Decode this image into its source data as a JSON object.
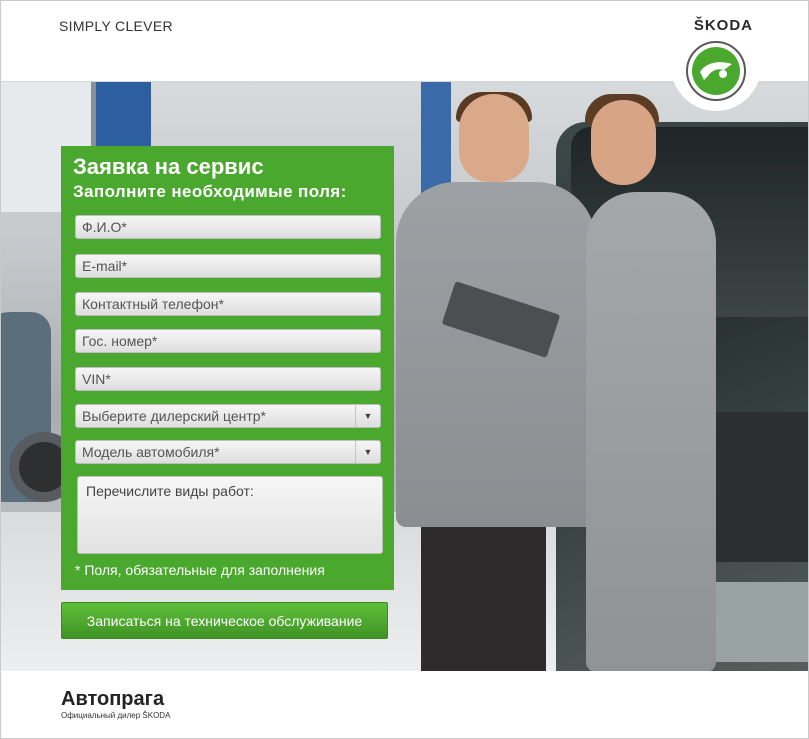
{
  "header": {
    "tagline": "SIMPLY CLEVER",
    "brand": "ŠKODA"
  },
  "colors": {
    "accent_green": "#4ba82e",
    "button_green": "#4fae30"
  },
  "form": {
    "title": "Заявка на сервис",
    "subtitle": "Заполните необходимые поля:",
    "fields": {
      "name": "Ф.И.О*",
      "email": "E-mail*",
      "phone": "Контактный телефон*",
      "plate": "Гос. номер*",
      "vin": "VIN*",
      "dealer": "Выберите дилерский центр*",
      "model": "Модель автомобиля*",
      "works": "Перечислите виды работ:"
    },
    "required_note": "* Поля, обязательные для заполнения",
    "submit_label": "Записаться на техническое обслуживание"
  },
  "footer": {
    "dealer_name": "Автопрага",
    "dealer_sub": "Официальный дилер ŠKODA"
  }
}
